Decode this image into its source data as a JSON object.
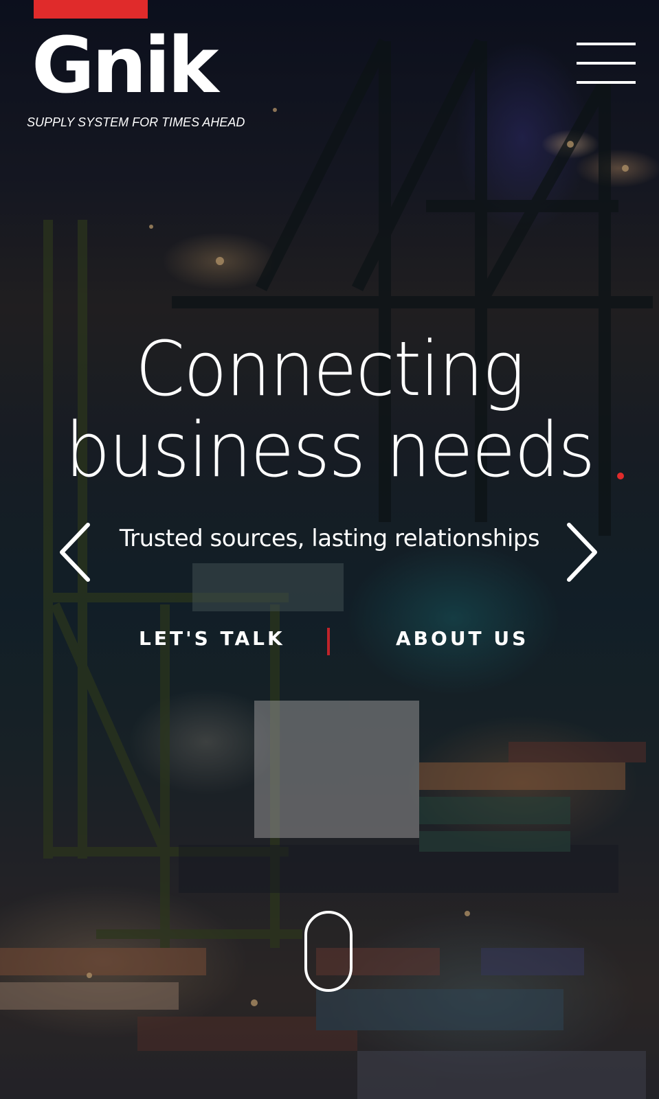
{
  "brand": {
    "name": "Gnik",
    "tagline": "SUPPLY SYSTEM FOR TIMES AHEAD",
    "accent_color": "#e02b2b"
  },
  "header": {
    "menu_icon": "hamburger-menu-icon"
  },
  "hero": {
    "headline_line1": "Connecting",
    "headline_line2": "business needs",
    "subheadline": "Trusted sources, lasting relationships",
    "prev_icon": "chevron-left-icon",
    "next_icon": "chevron-right-icon",
    "cta_primary": "LET'S TALK",
    "cta_secondary": "ABOUT US",
    "scroll_icon": "mouse-scroll-icon"
  }
}
